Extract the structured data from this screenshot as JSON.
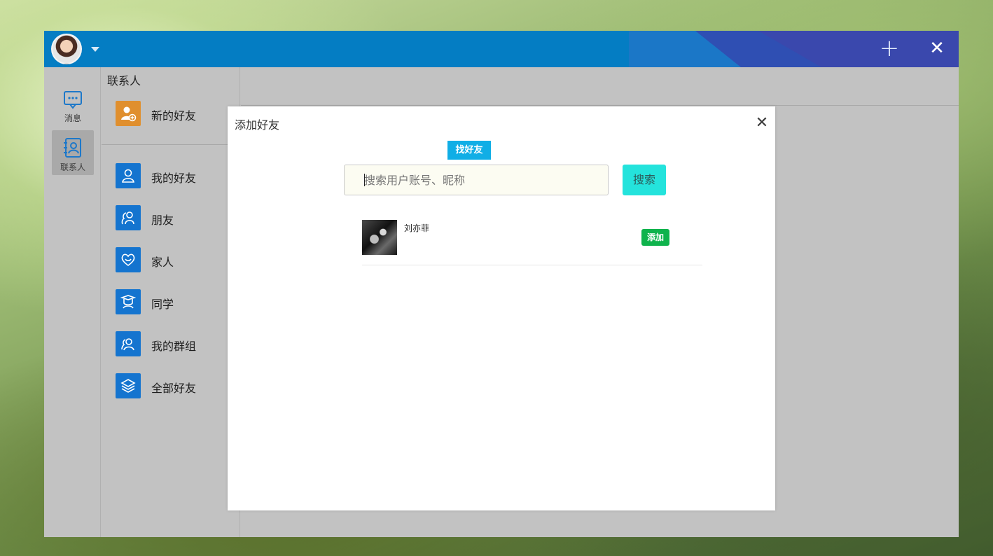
{
  "window": {
    "title_icons": {
      "add": "+",
      "close": "✕"
    }
  },
  "nav": {
    "items": [
      {
        "label": "消息",
        "icon": "message-icon"
      },
      {
        "label": "联系人",
        "icon": "contacts-icon"
      }
    ]
  },
  "contacts": {
    "title": "联系人",
    "new_friends": "新的好友",
    "groups": [
      {
        "label": "我的好友",
        "icon": "user-icon"
      },
      {
        "label": "朋友",
        "icon": "friends-icon"
      },
      {
        "label": "家人",
        "icon": "heart-icon"
      },
      {
        "label": "同学",
        "icon": "graduation-icon"
      },
      {
        "label": "我的群组",
        "icon": "group-icon"
      },
      {
        "label": "全部好友",
        "icon": "layers-icon"
      }
    ]
  },
  "dialog": {
    "title": "添加好友",
    "close": "✕",
    "tab": "找好友",
    "search": {
      "placeholder": "搜索用户账号、昵称",
      "value": ""
    },
    "search_button": "搜索",
    "results": [
      {
        "name": "刘亦菲",
        "action": "添加"
      }
    ]
  },
  "colors": {
    "titlebar": "#047dc3",
    "panel_bg": "#c2c2c2",
    "tile_blue": "#1474cf",
    "tile_orange": "#e08f2e",
    "tab_blue": "#10aee6",
    "search_btn": "#24e3dc",
    "add_green": "#0fb34c"
  }
}
